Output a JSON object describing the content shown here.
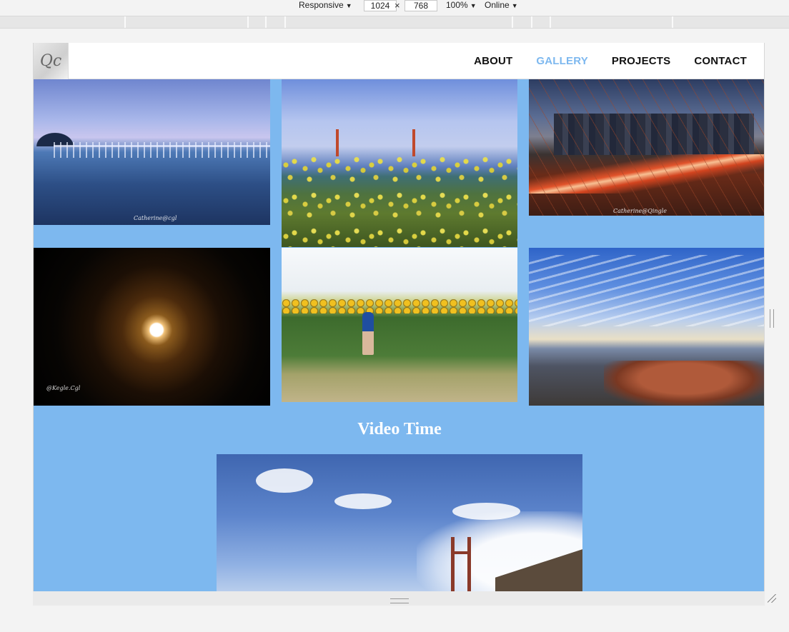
{
  "devtools": {
    "device": "Responsive",
    "width": "1024",
    "height": "768",
    "zoom": "100%",
    "network": "Online"
  },
  "site": {
    "logo_text": "Qc",
    "nav": [
      {
        "label": "ABOUT",
        "active": false
      },
      {
        "label": "GALLERY",
        "active": true
      },
      {
        "label": "PROJECTS",
        "active": false
      },
      {
        "label": "CONTACT",
        "active": false
      }
    ],
    "accent_color": "#7db8ef",
    "gallery": [
      {
        "name": "lake-pier-photo",
        "signature": "Catherine@cgl"
      },
      {
        "name": "golden-gate-wildflowers-photo",
        "signature": ""
      },
      {
        "name": "brooklyn-bridge-night-photo",
        "signature": "Catherine@Qingle"
      },
      {
        "name": "full-moon-clouds-photo",
        "signature": "@Kegle.Cgl"
      },
      {
        "name": "sunflower-field-photo",
        "signature": ""
      },
      {
        "name": "mountain-summit-photo",
        "signature": ""
      }
    ],
    "video_title": "Video Time"
  }
}
